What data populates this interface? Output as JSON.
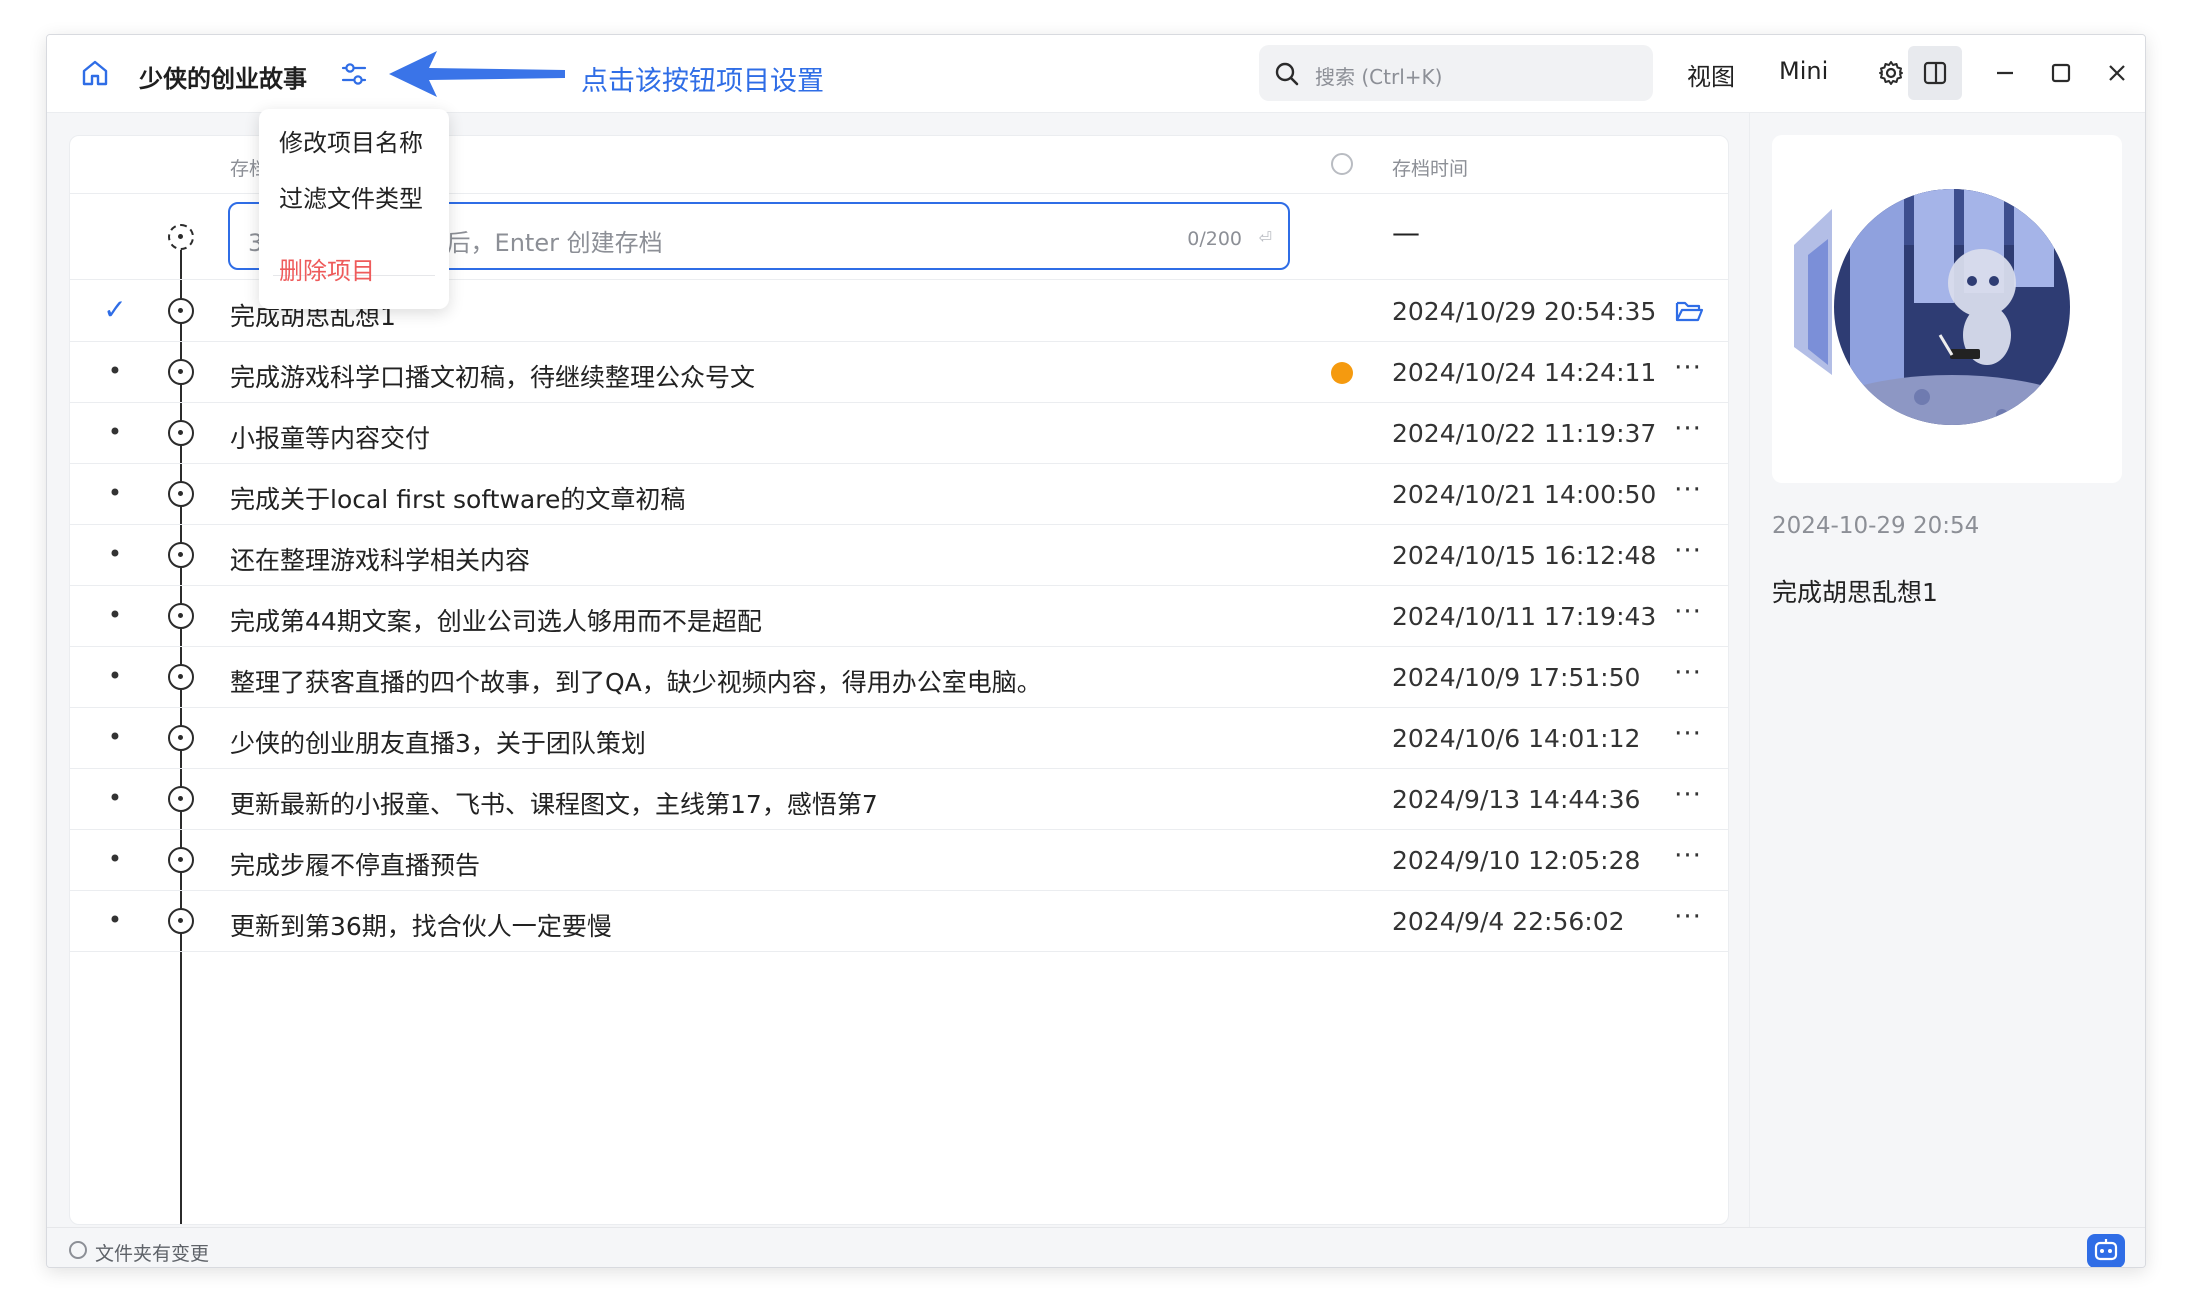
{
  "app": {
    "project_title": "少侠的创业故事",
    "annotation": "点击该按钮项目设置"
  },
  "search": {
    "placeholder": "搜索 (Ctrl+K)"
  },
  "toolbar": {
    "view_label": "视图",
    "mini_label": "Mini"
  },
  "menu": {
    "items": [
      {
        "label": "修改项目名称"
      },
      {
        "label": "过滤文件类型"
      },
      {
        "label": "删除项目",
        "danger": true
      }
    ]
  },
  "list": {
    "header_col1": "存档",
    "header_col2": "存档时间",
    "input": {
      "placeholder_visible": "37，输入存档说明后，Enter 创建存档",
      "count": "0/200",
      "time_placeholder": "—"
    },
    "rows": [
      {
        "text": "完成胡思乱想1",
        "time": "2024/10/29 20:54:35",
        "current": true
      },
      {
        "text": "完成游戏科学口播文初稿，待继续整理公众号文",
        "time": "2024/10/24 14:24:11",
        "flagged": true
      },
      {
        "text": "小报童等内容交付",
        "time": "2024/10/22 11:19:37"
      },
      {
        "text": "完成关于local first software的文章初稿",
        "time": "2024/10/21 14:00:50"
      },
      {
        "text": "还在整理游戏科学相关内容",
        "time": "2024/10/15 16:12:48"
      },
      {
        "text": "完成第44期文案，创业公司选人够用而不是超配",
        "time": "2024/10/11 17:19:43"
      },
      {
        "text": "整理了获客直播的四个故事，到了QA，缺少视频内容，得用办公室电脑。",
        "time": "2024/10/9 17:51:50"
      },
      {
        "text": "少侠的创业朋友直播3，关于团队策划",
        "time": "2024/10/6 14:01:12"
      },
      {
        "text": "更新最新的小报童、飞书、课程图文，主线第17，感悟第7",
        "time": "2024/9/13 14:44:36"
      },
      {
        "text": "完成步履不停直播预告",
        "time": "2024/9/10 12:05:28"
      },
      {
        "text": "更新到第36期，找合伙人一定要慢",
        "time": "2024/9/4 22:56:02"
      }
    ]
  },
  "preview": {
    "time": "2024-10-29 20:54",
    "title": "完成胡思乱想1"
  },
  "status": {
    "text": "文件夹有变更"
  },
  "colors": {
    "accent": "#2f6de6",
    "danger": "#ee5b5b",
    "flag": "#f59a0f"
  }
}
